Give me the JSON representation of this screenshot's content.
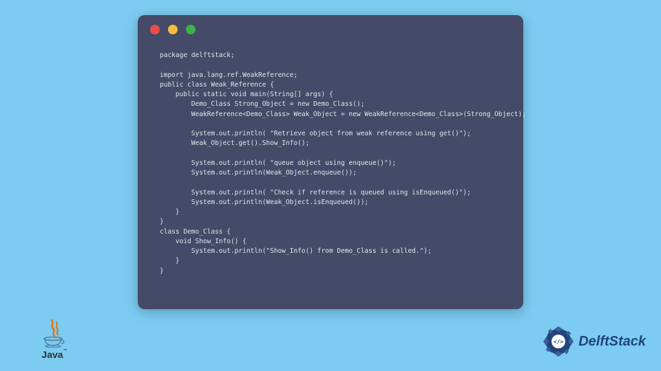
{
  "colors": {
    "page_bg": "#7cccf2",
    "window_bg": "#444a67",
    "code_fg": "#e4e6ee",
    "traffic_red": "#e94f4a",
    "traffic_yellow": "#f2bd3f",
    "traffic_green": "#3bb24a",
    "java_orange": "#e76f00",
    "java_blue": "#5382a1",
    "delft_blue": "#23447a"
  },
  "code": "package delftstack;\n\nimport java.lang.ref.WeakReference;\npublic class Weak_Reference {\n    public static void main(String[] args) {\n        Demo_Class Strong_Object = new Demo_Class();\n        WeakReference<Demo_Class> Weak_Object = new WeakReference<Demo_Class>(Strong_Object);\n\n        System.out.println( \"Retrieve object from weak reference using get()\");\n        Weak_Object.get().Show_Info();\n\n        System.out.println( \"queue object using enqueue()\");\n        System.out.println(Weak_Object.enqueue());\n\n        System.out.println( \"Check if reference is queued using isEnqueued()\");\n        System.out.println(Weak_Object.isEnqueued());\n    }\n}\nclass Demo_Class {\n    void Show_Info() {\n        System.out.println(\"Show_Info() from Demo_Class is called.\");\n    }\n}",
  "java_logo": {
    "label": "Java",
    "trademark": "™"
  },
  "delft_logo": {
    "label": "DelftStack",
    "badge_glyph": "</>"
  }
}
